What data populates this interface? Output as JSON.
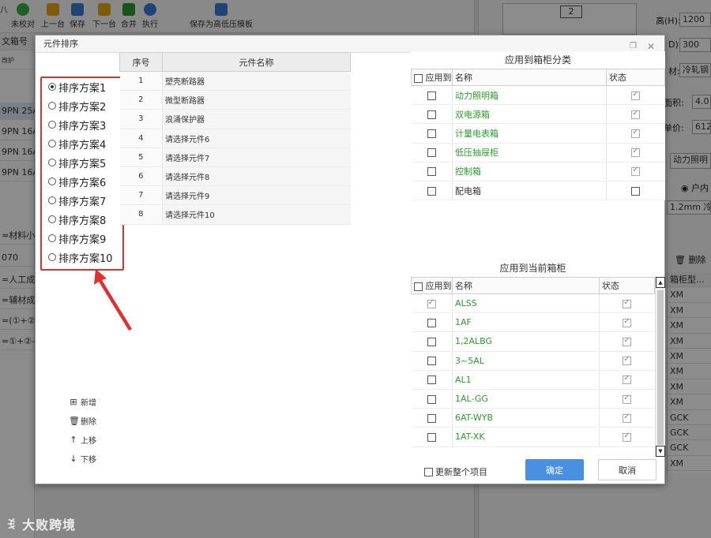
{
  "background": {
    "toolbar": [
      {
        "label": "未校对",
        "icon": "check-circle-icon",
        "color": "#3cb043"
      },
      {
        "label": "上一台",
        "icon": "skip-back-icon",
        "color": "#e6a817"
      },
      {
        "label": "保存",
        "icon": "save-icon",
        "color": "#3a7bd5"
      },
      {
        "label": "下一台",
        "icon": "skip-forward-icon",
        "color": "#e6a817"
      },
      {
        "label": "合并",
        "icon": "merge-icon",
        "color": "#2e9c2e"
      },
      {
        "label": "执行",
        "icon": "play-icon",
        "color": "#3a7bd5"
      },
      {
        "label": "保存为高低压模板",
        "icon": "template-icon",
        "color": "#3a7bd5"
      }
    ],
    "toolbar_partial": "八",
    "left_header": "文箱号",
    "left_button": "改护",
    "left_rows": [
      "9PN 25A",
      "9PN 16A",
      "9PN 16A",
      "9PN 16A",
      "",
      "=材料小",
      "070",
      "=人工成",
      "=辅材成",
      "=(①+②",
      "=①+②-"
    ],
    "right": {
      "drawing_number": "2",
      "height_label": "高(H):",
      "height_value": "1200",
      "depth_label": "D):",
      "depth_value": "300",
      "material_label": "材:",
      "material_value": "冷轧钢",
      "area_label": "面积:",
      "area_value": "4.0",
      "unit_label": "单价:",
      "unit_value": "612",
      "category_value": "动力照明",
      "radio_label": "户内",
      "thickness_value": "1.2mm 冷轧",
      "delete_label": "删除",
      "grid_header": "箱柜型...",
      "grid_rows": [
        "XM",
        "XM",
        "XM",
        "XM",
        "XM",
        "XM",
        "XM",
        "XM",
        "GCK",
        "GCK",
        "GCK",
        "XM"
      ]
    }
  },
  "dialog": {
    "title": "元件排序",
    "schemes": [
      {
        "label": "排序方案1",
        "selected": true
      },
      {
        "label": "排序方案2",
        "selected": false
      },
      {
        "label": "排序方案3",
        "selected": false
      },
      {
        "label": "排序方案4",
        "selected": false
      },
      {
        "label": "排序方案5",
        "selected": false
      },
      {
        "label": "排序方案6",
        "selected": false
      },
      {
        "label": "排序方案7",
        "selected": false
      },
      {
        "label": "排序方案8",
        "selected": false
      },
      {
        "label": "排序方案9",
        "selected": false
      },
      {
        "label": "排序方案10",
        "selected": false
      }
    ],
    "actions": [
      {
        "label": "新增",
        "icon": "plus-square-icon"
      },
      {
        "label": "删除",
        "icon": "trash-icon"
      },
      {
        "label": "上移",
        "icon": "arrow-up-icon"
      },
      {
        "label": "下移",
        "icon": "arrow-down-icon"
      }
    ],
    "component_table": {
      "headers": [
        "序号",
        "元件名称"
      ],
      "rows": [
        {
          "no": "1",
          "name": "塑壳断路器"
        },
        {
          "no": "2",
          "name": "微型断路器"
        },
        {
          "no": "3",
          "name": "浪涌保护器"
        },
        {
          "no": "4",
          "name": "请选择元件6"
        },
        {
          "no": "5",
          "name": "请选择元件7"
        },
        {
          "no": "6",
          "name": "请选择元件8"
        },
        {
          "no": "7",
          "name": "请选择元件9"
        },
        {
          "no": "8",
          "name": "请选择元件10"
        }
      ]
    },
    "category_panel": {
      "title": "应用到箱柜分类",
      "headers": [
        "应用到",
        "名称",
        "状态"
      ],
      "rows": [
        {
          "name": "动力照明箱",
          "applied": false,
          "status": true
        },
        {
          "name": "双电源箱",
          "applied": false,
          "status": true
        },
        {
          "name": "计量电表箱",
          "applied": false,
          "status": true
        },
        {
          "name": "低压抽屉柜",
          "applied": false,
          "status": true
        },
        {
          "name": "控制箱",
          "applied": false,
          "status": true
        },
        {
          "name": "配电箱",
          "applied": false,
          "status": false
        }
      ]
    },
    "current_panel": {
      "title": "应用到当前箱柜",
      "headers": [
        "应用到",
        "名称",
        "状态"
      ],
      "rows": [
        {
          "name": "ALSS",
          "applied": true,
          "status": true
        },
        {
          "name": "1AF",
          "applied": false,
          "status": true
        },
        {
          "name": "1,2ALBG",
          "applied": false,
          "status": true
        },
        {
          "name": "3~5AL",
          "applied": false,
          "status": true
        },
        {
          "name": "AL1",
          "applied": false,
          "status": true
        },
        {
          "name": "1AL-GG",
          "applied": false,
          "status": true
        },
        {
          "name": "6AT-WYB",
          "applied": false,
          "status": true
        },
        {
          "name": "1AT-XK",
          "applied": false,
          "status": true
        }
      ]
    },
    "update_project_label": "更新整个项目",
    "ok_label": "确定",
    "cancel_label": "取消"
  },
  "watermark": "大败跨境",
  "colors": {
    "accent": "#4a90e2",
    "highlight": "#e03030",
    "green_text": "#2e9c2e"
  }
}
